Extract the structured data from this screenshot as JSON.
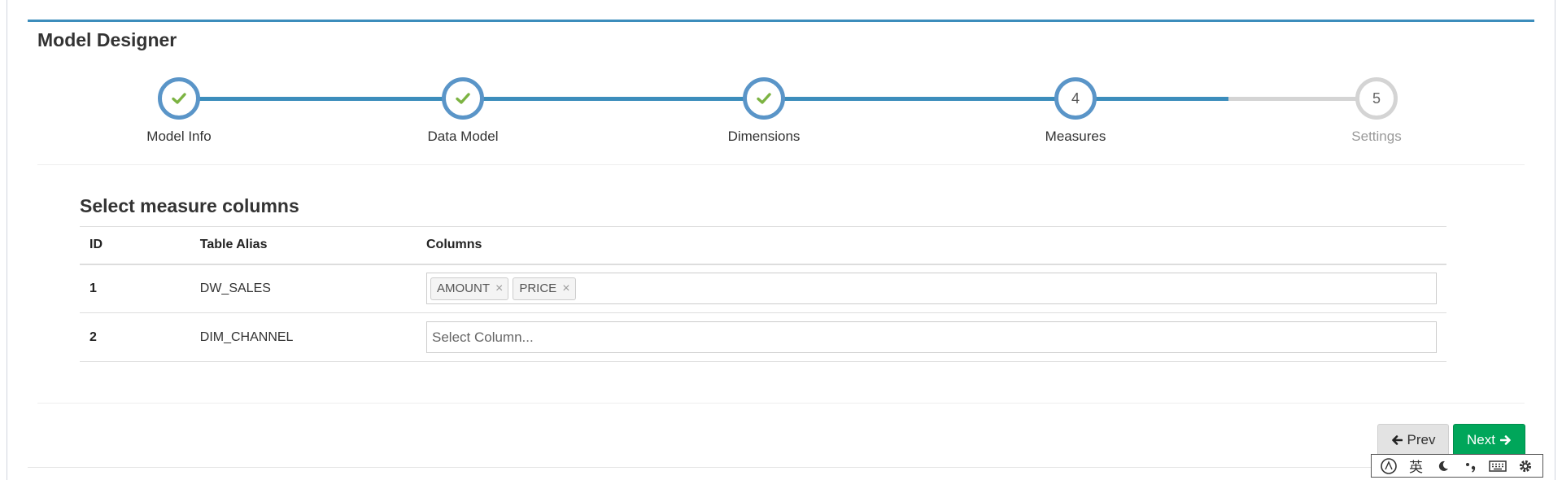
{
  "page": {
    "title": "Model Designer"
  },
  "steps": [
    {
      "label": "Model Info",
      "state": "done"
    },
    {
      "label": "Data Model",
      "state": "done"
    },
    {
      "label": "Dimensions",
      "state": "done"
    },
    {
      "label": "Measures",
      "number": "4",
      "state": "current"
    },
    {
      "label": "Settings",
      "number": "5",
      "state": "todo"
    }
  ],
  "measures": {
    "title": "Select measure columns",
    "headers": {
      "id": "ID",
      "alias": "Table Alias",
      "columns": "Columns"
    },
    "rows": [
      {
        "id": "1",
        "alias": "DW_SALES",
        "columns": [
          "AMOUNT",
          "PRICE"
        ]
      },
      {
        "id": "2",
        "alias": "DIM_CHANNEL",
        "placeholder": "Select Column..."
      }
    ]
  },
  "buttons": {
    "prev": "Prev",
    "next": "Next"
  },
  "ime": {
    "lang": "英"
  },
  "colors": {
    "primary": "#3c8dbc",
    "success": "#00a65a",
    "check": "#7cb342",
    "pending": "#d4d4d4"
  }
}
